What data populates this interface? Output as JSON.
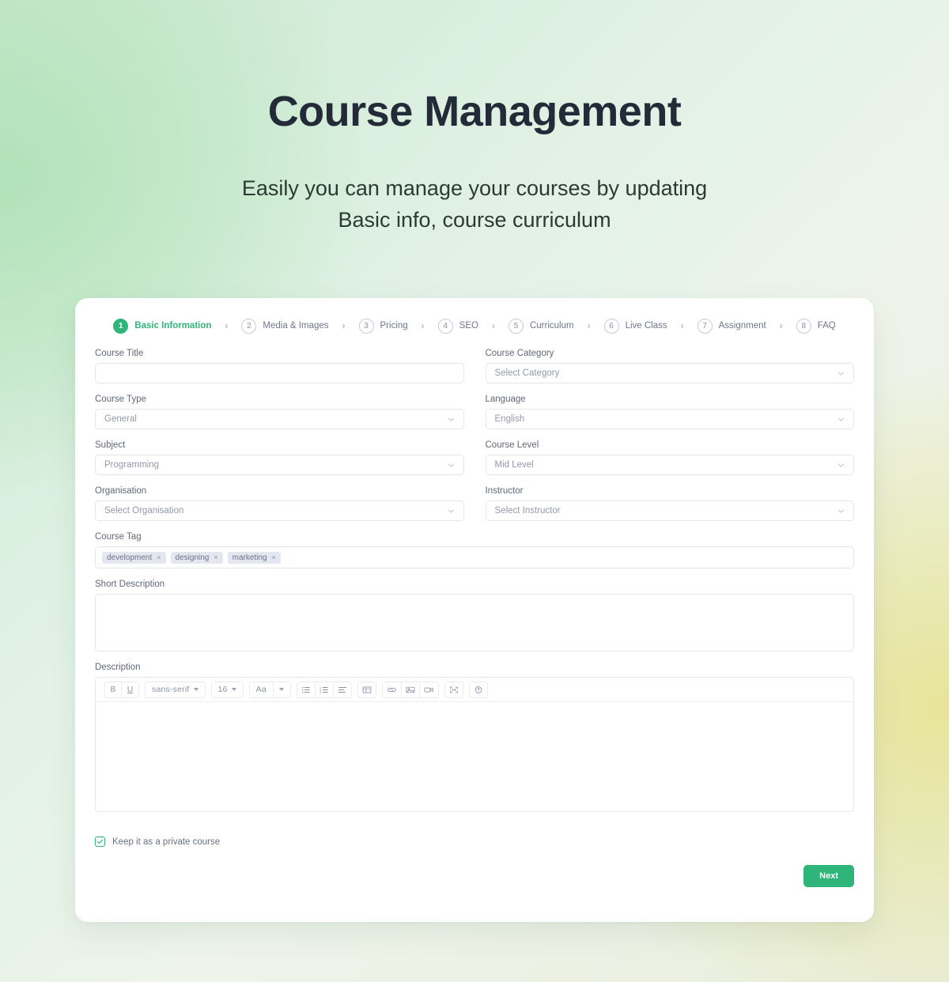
{
  "hero": {
    "title": "Course Management",
    "subtitle_line1": "Easily you can manage your courses by updating",
    "subtitle_line2": "Basic info, course curriculum"
  },
  "colors": {
    "accent_green": "#2fb579",
    "title_dark": "#232b38",
    "label_gray": "#5f6878",
    "placeholder_gray": "#9299ab",
    "border_gray": "#e3e6ee",
    "tag_bg": "#e4e7f0"
  },
  "stepper": {
    "separator": "›",
    "steps": [
      {
        "num": "1",
        "label": "Basic Information",
        "active": true
      },
      {
        "num": "2",
        "label": "Media & Images",
        "active": false
      },
      {
        "num": "3",
        "label": "Pricing",
        "active": false
      },
      {
        "num": "4",
        "label": "SEO",
        "active": false
      },
      {
        "num": "5",
        "label": "Curriculum",
        "active": false
      },
      {
        "num": "6",
        "label": "Live Class",
        "active": false
      },
      {
        "num": "7",
        "label": "Assignment",
        "active": false
      },
      {
        "num": "8",
        "label": "FAQ",
        "active": false
      }
    ]
  },
  "form": {
    "course_title": {
      "label": "Course Title",
      "value": "",
      "placeholder": ""
    },
    "course_category": {
      "label": "Course Category",
      "value": "Select Category"
    },
    "course_type": {
      "label": "Course Type",
      "value": "General"
    },
    "language": {
      "label": "Language",
      "value": "English"
    },
    "subject": {
      "label": "Subject",
      "value": "Programming"
    },
    "course_level": {
      "label": "Course Level",
      "value": "Mid Level"
    },
    "organisation": {
      "label": "Organisation",
      "value": "Select Organisation"
    },
    "instructor": {
      "label": "Instructor",
      "value": "Select Instructor"
    },
    "course_tag": {
      "label": "Course Tag",
      "tags": [
        "development",
        "designing",
        "marketing"
      ],
      "remove_glyph": "×"
    },
    "short_description": {
      "label": "Short Description",
      "value": ""
    },
    "description": {
      "label": "Description",
      "value": ""
    }
  },
  "editor_toolbar": {
    "bold": "B",
    "underline": "U",
    "font_family": "sans-serif",
    "font_size": "16",
    "text_style": "Aa",
    "icons": [
      "bullet-list-icon",
      "numbered-list-icon",
      "align-left-icon",
      "table-icon",
      "link-icon",
      "image-icon",
      "video-icon",
      "fullscreen-icon",
      "help-icon"
    ]
  },
  "footer": {
    "private_checkbox_label": "Keep it as a private course",
    "private_checked": true,
    "next_button": "Next"
  }
}
